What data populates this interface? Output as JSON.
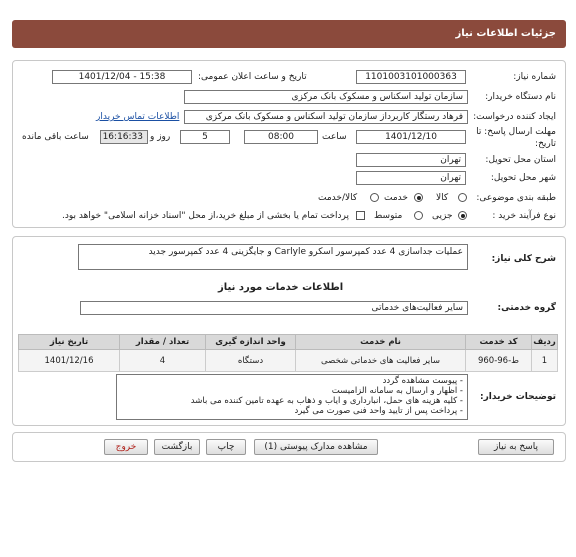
{
  "header": {
    "title": "جزئیات اطلاعات نیاز"
  },
  "fields": {
    "need_number_label": "شماره نیاز:",
    "need_number": "1101003101000363",
    "announce_label": "تاریخ و ساعت اعلان عمومی:",
    "announce_value": "1401/12/04 - 15:38",
    "buyer_label": "نام دستگاه خریدار:",
    "buyer_value": "سازمان تولید اسکناس و مسکوک بانک مرکزی",
    "creator_label": "ایجاد کننده درخواست:",
    "creator_value": "فرهاد رستگار کاربرداز سازمان تولید اسکناس و مسکوک بانک مرکزی",
    "contact_link": "اطلاعات تماس خریدار",
    "deadline_label": "مهلت ارسال پاسخ: تا",
    "deadline_label2": "تاریخ:",
    "deadline_date": "1401/12/10",
    "time_label": "ساعت",
    "deadline_time": "08:00",
    "days_value": "5",
    "days_label": "روز و",
    "remain_time": "16:16:33",
    "remain_label": "ساعت باقی مانده",
    "province_label": "استان محل تحویل:",
    "province_value": "تهران",
    "city_label": "شهر محل تحویل:",
    "city_value": "تهران",
    "category_label": "طبقه بندی موضوعی:",
    "cat_goods": "کالا",
    "cat_service": "خدمت",
    "cat_goods_service": "کالا/خدمت",
    "process_label": "نوع فرآیند خرید :",
    "proc_partial": "جزیی",
    "proc_medium": "متوسط",
    "payment_note": "پرداخت تمام یا بخشی از مبلغ خرید،از محل \"اسناد خزانه اسلامی\" خواهد بود."
  },
  "summary": {
    "label": "شرح کلی نیاز:",
    "value": "عملیات جداسازی 4 عدد کمپرسور اسکرو Carlyle و جایگزینی 4 عدد کمپرسور جدید"
  },
  "services": {
    "title": "اطلاعات خدمات مورد نیاز",
    "group_label": "گروه خدمتی:",
    "group_value": "سایر فعالیت‌های خدماتی",
    "headers": [
      "ردیف",
      "کد خدمت",
      "نام خدمت",
      "واحد اندازه گیری",
      "تعداد / مقدار",
      "تاریخ نیاز"
    ],
    "rows": [
      [
        "1",
        "ط-96-960",
        "سایر فعالیت های خدماتی شخصی",
        "دستگاه",
        "4",
        "1401/12/16"
      ]
    ]
  },
  "notes": {
    "label": "توضیحات خریدار:",
    "lines": [
      "- پیوست مشاهده گردد",
      "- اظهار و ارسال به سامانه الزامیست",
      "- کلیه هزینه های حمل، انبارداری و ایاب و ذهاب به عهده تامین کننده می باشد",
      "- پرداخت پس از تایید واحد فنی صورت می گیرد"
    ]
  },
  "buttons": {
    "reply": "پاسخ به نیاز",
    "attachments": "مشاهده مدارک پیوستی (1)",
    "print": "چاپ",
    "back": "بازگشت",
    "exit": "خروج"
  }
}
